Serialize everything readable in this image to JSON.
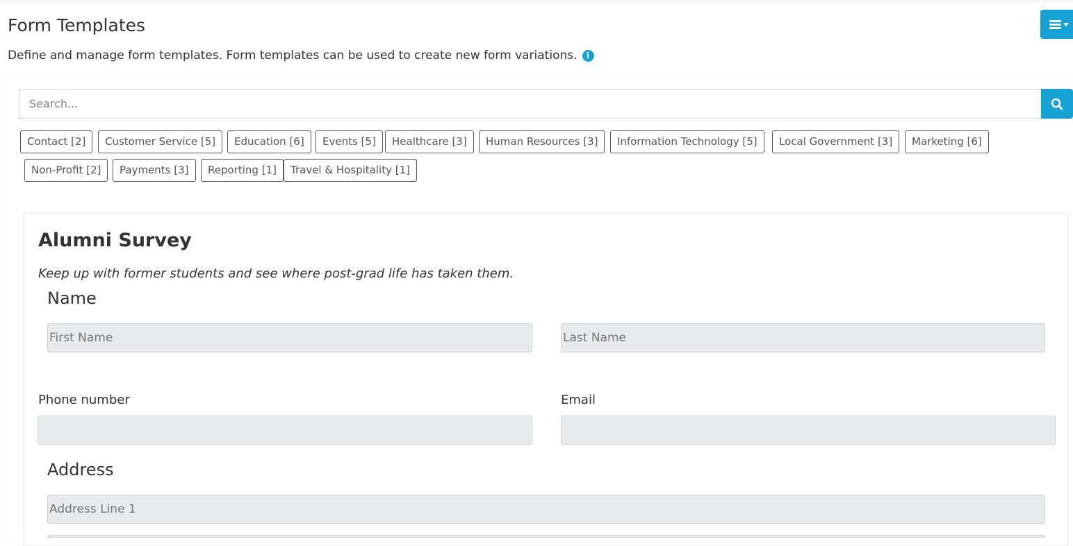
{
  "header": {
    "title": "Form Templates",
    "subtitle": "Define and manage form templates. Form templates can be used to create new form variations.",
    "info_icon": "i",
    "menu_icon": "hamburger-menu-icon",
    "accent_color": "#17a2d6"
  },
  "search": {
    "placeholder": "Search...",
    "button_icon": "search-icon"
  },
  "categories": [
    {
      "label": "Contact [2]"
    },
    {
      "label": "Customer Service [5]"
    },
    {
      "label": "Education [6]"
    },
    {
      "label": "Events [5]"
    },
    {
      "label": "Healthcare [3]"
    },
    {
      "label": "Human Resources [3]"
    },
    {
      "label": "Information Technology [5]"
    },
    {
      "label": "Local Government [3]"
    },
    {
      "label": "Marketing [6]"
    },
    {
      "label": "Non-Profit [2]"
    },
    {
      "label": "Payments [3]"
    },
    {
      "label": "Reporting [1]"
    },
    {
      "label": "Travel & Hospitality [1]"
    }
  ],
  "form_preview": {
    "title": "Alumni Survey",
    "description": "Keep up with former students and see where post-grad life has taken them.",
    "name_section": "Name",
    "first_name_placeholder": "First Name",
    "last_name_placeholder": "Last Name",
    "phone_label": "Phone number",
    "email_label": "Email",
    "address_section": "Address",
    "address_line1_placeholder": "Address Line 1"
  }
}
